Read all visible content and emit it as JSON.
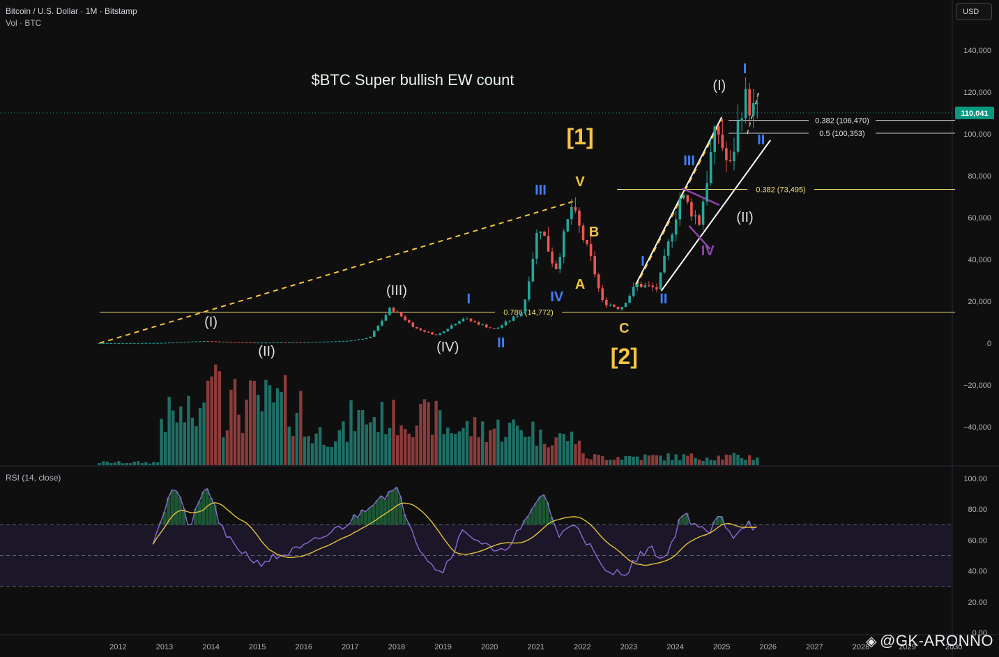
{
  "header": {
    "symbol_line": "Bitcoin / U.S. Dollar · 1M · Bitstamp",
    "volume_line": "Vol · BTC"
  },
  "currency_button": "USD",
  "rsi_label": "RSI (14, close)",
  "watermark": "@GK-ARONNO",
  "colors": {
    "background": "#0f0f0f",
    "up": "#26a69a",
    "down": "#ef5350",
    "vol_up": "#1f6f66",
    "vol_down": "#8c3b3a",
    "fib": "#f5e27a",
    "wave_white": "#e0e0e0",
    "wave_blue": "#3f7fff",
    "wave_yellow": "#f5c542",
    "rsi": "#8e6bd6",
    "rsi_ma": "#e6c338",
    "last_price": "#089981"
  },
  "chart_data": {
    "type": "candlestick",
    "title": "$BTC Super bullish EW count",
    "x_ticks": [
      "2012",
      "2013",
      "2014",
      "2015",
      "2016",
      "2017",
      "2018",
      "2019",
      "2020",
      "2021",
      "2022",
      "2023",
      "2024",
      "2025",
      "2026",
      "2027",
      "2028",
      "2029",
      "2030"
    ],
    "y_ticks": [
      "140,000",
      "120,000",
      "100,000",
      "80,000",
      "60,000",
      "40,000",
      "20,000",
      "0",
      "−20,000",
      "−40,000"
    ],
    "ylim": [
      -58000,
      150000
    ],
    "last_price": 110041,
    "last_price_label": "110,041",
    "price_path": [
      {
        "t": 2011.6,
        "p": 5
      },
      {
        "t": 2013.0,
        "p": 100
      },
      {
        "t": 2013.9,
        "p": 1000
      },
      {
        "t": 2015.0,
        "p": 250
      },
      {
        "t": 2016.0,
        "p": 430
      },
      {
        "t": 2017.0,
        "p": 1000
      },
      {
        "t": 2017.5,
        "p": 2500
      },
      {
        "t": 2017.96,
        "p": 17000
      },
      {
        "t": 2018.5,
        "p": 7000
      },
      {
        "t": 2018.95,
        "p": 3700
      },
      {
        "t": 2019.5,
        "p": 12000
      },
      {
        "t": 2020.2,
        "p": 6500
      },
      {
        "t": 2020.8,
        "p": 15000
      },
      {
        "t": 2021.15,
        "p": 58000
      },
      {
        "t": 2021.5,
        "p": 35000
      },
      {
        "t": 2021.85,
        "p": 65000
      },
      {
        "t": 2022.3,
        "p": 38000
      },
      {
        "t": 2022.5,
        "p": 20000
      },
      {
        "t": 2022.9,
        "p": 16500
      },
      {
        "t": 2023.25,
        "p": 28000
      },
      {
        "t": 2023.7,
        "p": 26000
      },
      {
        "t": 2024.2,
        "p": 71000
      },
      {
        "t": 2024.6,
        "p": 58000
      },
      {
        "t": 2024.9,
        "p": 96000
      },
      {
        "t": 2025.0,
        "p": 102000
      },
      {
        "t": 2025.25,
        "p": 82000
      },
      {
        "t": 2025.55,
        "p": 118000
      },
      {
        "t": 2025.8,
        "p": 110041
      }
    ],
    "fib_levels": [
      {
        "label": "0.786 (14,772)",
        "value": 14772
      },
      {
        "label": "0.382 (73,495)",
        "value": 73495
      },
      {
        "label": "0.382 (106,470)",
        "value": 106470
      },
      {
        "label": "0.5 (100,353)",
        "value": 100353
      }
    ],
    "wave_labels": [
      {
        "text": "(I)",
        "color": "white",
        "t": 2014.0,
        "p": 8000
      },
      {
        "text": "(II)",
        "color": "white",
        "t": 2015.2,
        "p": -6000
      },
      {
        "text": "(III)",
        "color": "white",
        "t": 2018.0,
        "p": 23000
      },
      {
        "text": "(IV)",
        "color": "white",
        "t": 2019.1,
        "p": -4000
      },
      {
        "text": "I",
        "color": "blue",
        "t": 2019.55,
        "p": 19000
      },
      {
        "text": "II",
        "color": "blue",
        "t": 2020.25,
        "p": -2000
      },
      {
        "text": "III",
        "color": "blue",
        "t": 2021.1,
        "p": 71000
      },
      {
        "text": "IV",
        "color": "blue",
        "t": 2021.45,
        "p": 20000
      },
      {
        "text": "V",
        "color": "yellow",
        "t": 2021.95,
        "p": 75000
      },
      {
        "text": "[1]",
        "color": "yellow",
        "t": 2021.95,
        "p": 95000
      },
      {
        "text": "A",
        "color": "yellow",
        "t": 2021.95,
        "p": 26000
      },
      {
        "text": "B",
        "color": "yellow",
        "t": 2022.25,
        "p": 51000
      },
      {
        "text": "C",
        "color": "yellow",
        "t": 2022.9,
        "p": 5000
      },
      {
        "text": "[2]",
        "color": "yellow",
        "t": 2022.9,
        "p": -10000
      },
      {
        "text": "I",
        "color": "blue",
        "t": 2023.3,
        "p": 37000
      },
      {
        "text": "II",
        "color": "blue",
        "t": 2023.75,
        "p": 19000
      },
      {
        "text": "III",
        "color": "blue",
        "t": 2024.3,
        "p": 85000
      },
      {
        "text": "IV",
        "color": "purple",
        "t": 2024.7,
        "p": 42000
      },
      {
        "text": "(I)",
        "color": "white",
        "t": 2024.95,
        "p": 121000
      },
      {
        "text": "(II)",
        "color": "white",
        "t": 2025.5,
        "p": 58000
      },
      {
        "text": "I",
        "color": "blue",
        "t": 2025.5,
        "p": 129000
      },
      {
        "text": "II",
        "color": "blue",
        "t": 2025.85,
        "p": 95000
      }
    ],
    "rsi": {
      "label": "RSI (14, close)",
      "y_ticks": [
        "100.00",
        "80.00",
        "60.00",
        "40.00",
        "20.00",
        "0.00"
      ],
      "ylim": [
        0,
        100
      ],
      "band": [
        30,
        70
      ],
      "midline": 50,
      "values_approx": [
        {
          "t": 2012.75,
          "v": 60
        },
        {
          "t": 2013.2,
          "v": 96
        },
        {
          "t": 2013.55,
          "v": 68
        },
        {
          "t": 2013.9,
          "v": 96
        },
        {
          "t": 2014.3,
          "v": 62
        },
        {
          "t": 2015.0,
          "v": 45
        },
        {
          "t": 2016.0,
          "v": 55
        },
        {
          "t": 2017.0,
          "v": 72
        },
        {
          "t": 2017.6,
          "v": 88
        },
        {
          "t": 2018.0,
          "v": 92
        },
        {
          "t": 2018.5,
          "v": 55
        },
        {
          "t": 2018.95,
          "v": 38
        },
        {
          "t": 2019.45,
          "v": 67
        },
        {
          "t": 2020.2,
          "v": 50
        },
        {
          "t": 2020.8,
          "v": 72
        },
        {
          "t": 2021.15,
          "v": 92
        },
        {
          "t": 2021.5,
          "v": 62
        },
        {
          "t": 2021.85,
          "v": 72
        },
        {
          "t": 2022.5,
          "v": 38
        },
        {
          "t": 2022.95,
          "v": 40
        },
        {
          "t": 2023.4,
          "v": 55
        },
        {
          "t": 2023.8,
          "v": 48
        },
        {
          "t": 2024.15,
          "v": 78
        },
        {
          "t": 2024.7,
          "v": 63
        },
        {
          "t": 2024.95,
          "v": 76
        },
        {
          "t": 2025.25,
          "v": 63
        },
        {
          "t": 2025.55,
          "v": 72
        },
        {
          "t": 2025.8,
          "v": 66
        }
      ]
    }
  }
}
